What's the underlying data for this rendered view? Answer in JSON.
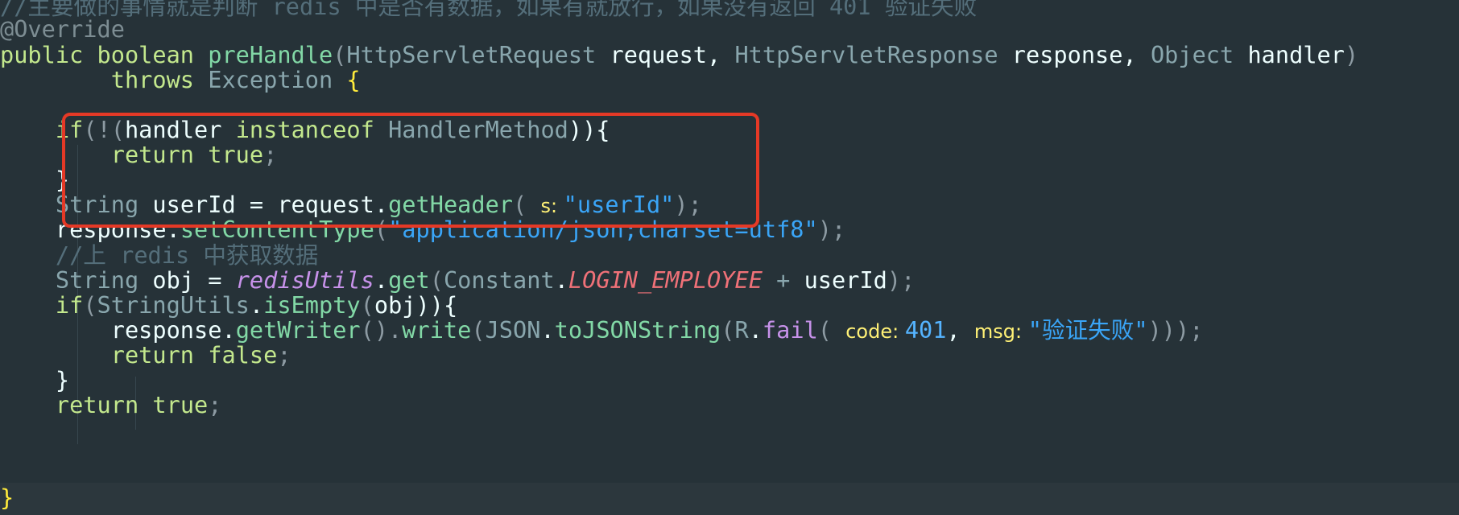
{
  "editor": {
    "lines": {
      "l0": {
        "comment": "//主要做的事情就是判断 redis 中是否有数据，如果有就放行，如果没有返回 401 验证失败"
      },
      "l1": {
        "annotation": "@Override"
      },
      "l2": {
        "kw1": "public ",
        "kw2": "boolean ",
        "method": "preHandle",
        "p1": "(",
        "type1": "HttpServletRequest ",
        "var1": "request",
        "comma1": ", ",
        "type2": "HttpServletResponse ",
        "var2": "response",
        "comma2": ", ",
        "type3": "Object ",
        "var3": "handler",
        "p2": ")"
      },
      "l3": {
        "indent": "        ",
        "kw": "throws ",
        "type": "Exception ",
        "brace": "{"
      },
      "l4": {
        "text": ""
      },
      "l5": {
        "indent": "    ",
        "kw": "if",
        "p1": "(!(",
        "var": "handler ",
        "kw2": "instanceof ",
        "type": "HandlerMethod",
        "p2": ")){"
      },
      "l6": {
        "indent": "        ",
        "kw": "return ",
        "val": "true",
        "semi": ";"
      },
      "l7": {
        "indent": "    ",
        "brace": "}"
      },
      "l8": {
        "indent": "    ",
        "type": "String ",
        "var": "userId ",
        "op": "= ",
        "obj": "request",
        "dot": ".",
        "call": "getHeader",
        "p1": "( ",
        "hint": "s: ",
        "str": "\"userId\"",
        "p2": ");"
      },
      "l9": {
        "indent": "    ",
        "obj": "response",
        "dot": ".",
        "call": "setContentType",
        "p1": "(",
        "str": "\"application/json;charset=utf8\"",
        "p2": ");"
      },
      "l10": {
        "indent": "    ",
        "comment": "//上 redis 中获取数据"
      },
      "l11": {
        "indent": "    ",
        "type": "String ",
        "var": "obj ",
        "op": "= ",
        "field": "redisUtils",
        "dot": ".",
        "call": "get",
        "p1": "(",
        "cls": "Constant",
        "dot2": ".",
        "const": "LOGIN_EMPLOYEE",
        "op2": " + ",
        "var2": "userId",
        "p2": ");"
      },
      "l12": {
        "indent": "    ",
        "kw": "if",
        "p1": "(",
        "cls": "StringUtils",
        "dot": ".",
        "call": "isEmpty",
        "p2": "(",
        "var": "obj",
        "p3": ")){"
      },
      "l13": {
        "indent": "        ",
        "obj": "response",
        "dot": ".",
        "call": "getWriter",
        "p1": "().",
        "call2": "write",
        "p2": "(",
        "cls": "JSON",
        "dot2": ".",
        "call3": "toJSONString",
        "p3": "(",
        "cls2": "R",
        "dot3": ".",
        "call4": "fail",
        "p4": "( ",
        "hint1": "code: ",
        "num": "401",
        "comma": ", ",
        "hint2": "msg: ",
        "str": "\"验证失败\"",
        "p5": ")));"
      },
      "l14": {
        "indent": "        ",
        "kw": "return ",
        "val": "false",
        "semi": ";"
      },
      "l15": {
        "indent": "    ",
        "brace": "}"
      },
      "l16": {
        "indent": "    ",
        "kw": "return ",
        "val": "true",
        "semi": ";"
      },
      "l17": {
        "brace": "}"
      }
    }
  },
  "colors": {
    "background": "#263238",
    "highlight_box": "#e53926",
    "keyword": "#c3e88d",
    "string": "#3aa5f7",
    "comment": "#546e7a"
  }
}
